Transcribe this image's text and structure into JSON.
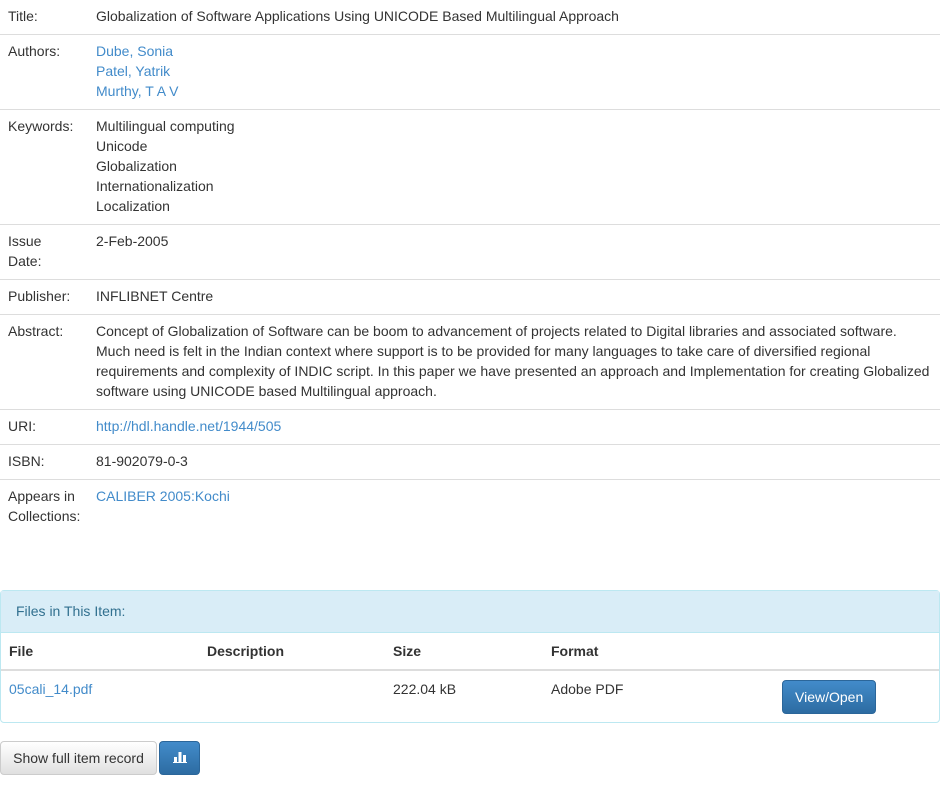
{
  "metadata": {
    "title": {
      "label": "Title:",
      "value": "Globalization of Software Applications Using UNICODE Based Multilingual Approach"
    },
    "authors": {
      "label": "Authors:",
      "values": [
        "Dube, Sonia",
        "Patel, Yatrik",
        "Murthy, T A V"
      ]
    },
    "keywords": {
      "label": "Keywords:",
      "values": [
        "Multilingual computing",
        "Unicode",
        "Globalization",
        "Internationalization",
        "Localization"
      ]
    },
    "issue_date": {
      "label_line1": "Issue",
      "label_line2": "Date:",
      "value": "2-Feb-2005"
    },
    "publisher": {
      "label": "Publisher:",
      "value": "INFLIBNET Centre"
    },
    "abstract": {
      "label": "Abstract:",
      "value": "Concept of Globalization of Software can be boom to advancement of projects related to Digital libraries and associated software. Much need is felt in the Indian context where support is to be provided for many languages to take care of diversified regional requirements and complexity of INDIC script. In this paper we have presented an approach and Implementation for creating Globalized software using UNICODE based Multilingual approach."
    },
    "uri": {
      "label": "URI:",
      "value": "http://hdl.handle.net/1944/505"
    },
    "isbn": {
      "label": "ISBN:",
      "value": "81-902079-0-3"
    },
    "collections": {
      "label_line1": "Appears in",
      "label_line2": "Collections:",
      "value": "CALIBER 2005:Kochi"
    }
  },
  "files": {
    "heading": "Files in This Item:",
    "columns": {
      "file": "File",
      "description": "Description",
      "size": "Size",
      "format": "Format"
    },
    "rows": [
      {
        "file": "05cali_14.pdf",
        "description": "",
        "size": "222.04 kB",
        "format": "Adobe PDF",
        "action": "View/Open"
      }
    ]
  },
  "actions": {
    "show_full": "Show full item record",
    "stats_icon": "bar-chart-icon"
  },
  "colors": {
    "link": "#428bca",
    "panel_heading_bg": "#d9edf7",
    "panel_heading_text": "#31708f",
    "primary_button": "#428bca"
  }
}
